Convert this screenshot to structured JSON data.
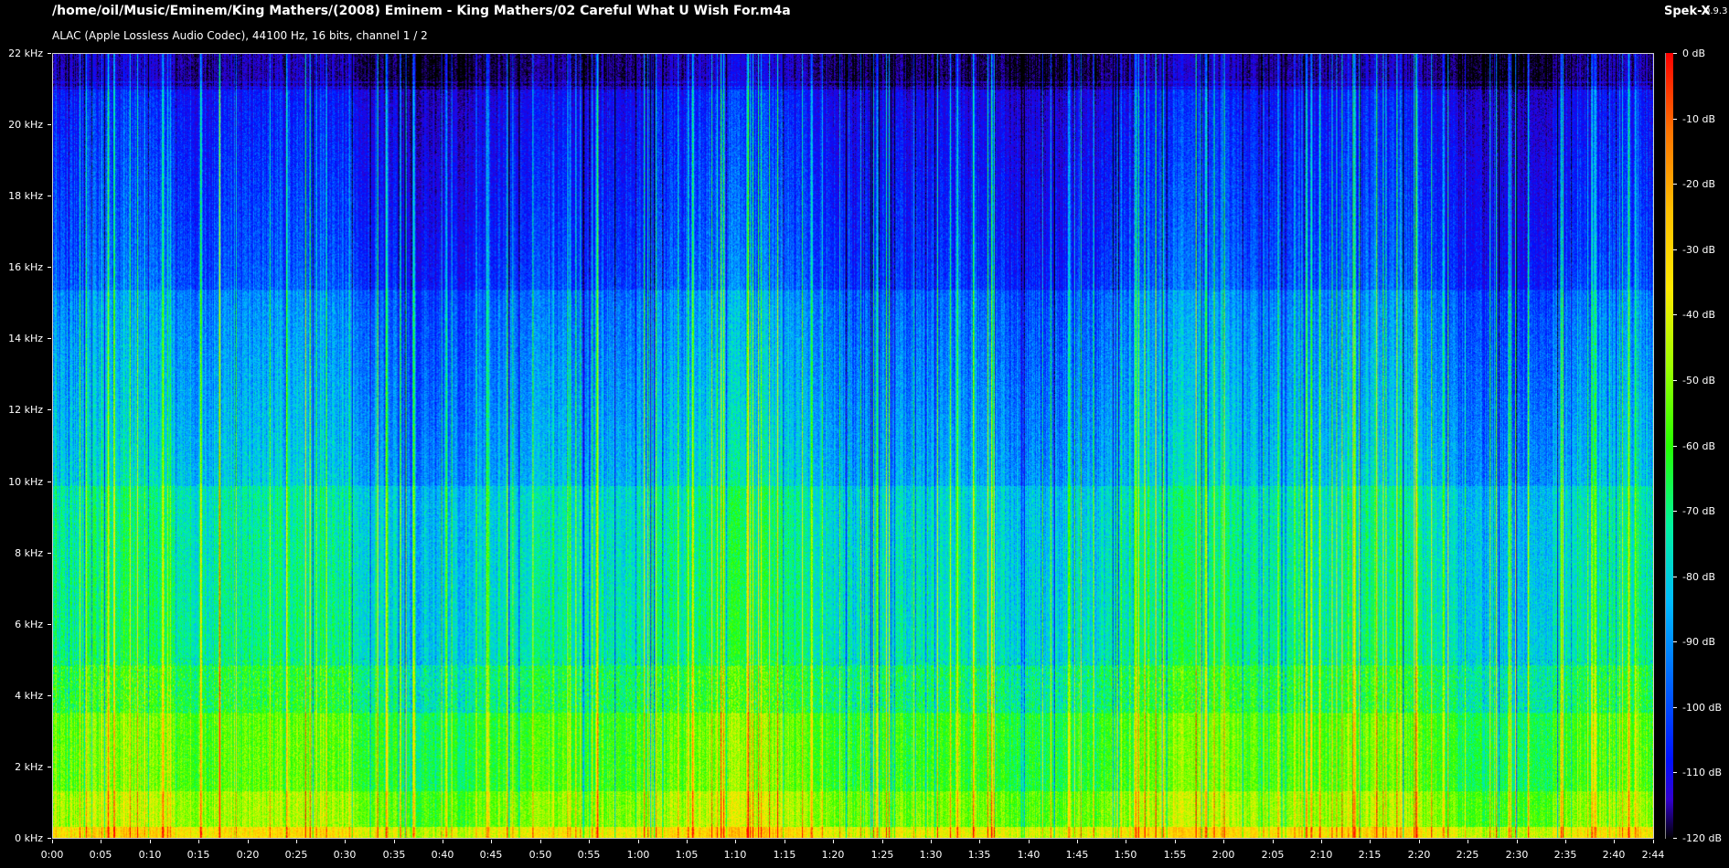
{
  "window": {
    "file_path": "/home/oil/Music/Eminem/King Mathers/(2008) Eminem - King Mathers/02 Careful What U Wish For.m4a",
    "file_info": "ALAC (Apple Lossless Audio Codec), 44100 Hz, 16 bits, channel 1 / 2",
    "app_name": "Spek-X",
    "app_version": "0.9.3"
  },
  "chart_data": {
    "type": "heatmap",
    "y_axis_unit": "kHz",
    "y_ticks": [
      "22 kHz",
      "20 kHz",
      "18 kHz",
      "16 kHz",
      "14 kHz",
      "12 kHz",
      "10 kHz",
      "8 kHz",
      "6 kHz",
      "4 kHz",
      "2 kHz",
      "0 kHz"
    ],
    "x_ticks": [
      "0:00",
      "0:05",
      "0:10",
      "0:15",
      "0:20",
      "0:25",
      "0:30",
      "0:35",
      "0:40",
      "0:45",
      "0:50",
      "0:55",
      "1:00",
      "1:05",
      "1:10",
      "1:15",
      "1:20",
      "1:25",
      "1:30",
      "1:35",
      "1:40",
      "1:45",
      "1:50",
      "1:55",
      "2:00",
      "2:05",
      "2:10",
      "2:15",
      "2:20",
      "2:25",
      "2:30",
      "2:35",
      "2:40",
      "2:44"
    ],
    "db_ticks": [
      "0 dB",
      "-10 dB",
      "-20 dB",
      "-30 dB",
      "-40 dB",
      "-50 dB",
      "-60 dB",
      "-70 dB",
      "-80 dB",
      "-90 dB",
      "-100 dB",
      "-110 dB",
      "-120 dB"
    ],
    "frequency_range_khz": [
      0,
      22
    ],
    "time_range_seconds": [
      0,
      164
    ],
    "db_range": [
      -120,
      0
    ],
    "colors": {
      "background": "#000000",
      "frame": "#cfcfcf",
      "scale": [
        "#000000",
        "#3300cf",
        "#0011ff",
        "#0066ff",
        "#00baff",
        "#00f59d",
        "#25ff00",
        "#9cff00",
        "#ffe900",
        "#ffbf00",
        "#ff7400",
        "#ff0000"
      ]
    }
  }
}
